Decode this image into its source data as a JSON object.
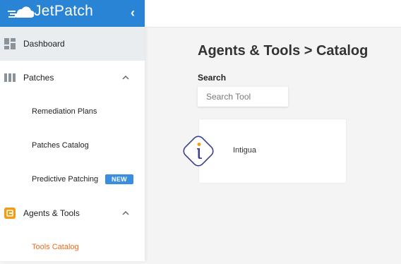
{
  "brand": {
    "name": "JetPatch"
  },
  "nav": {
    "dashboard": "Dashboard",
    "patches": "Patches",
    "patches_children": {
      "remediation_plans": "Remediation Plans",
      "patches_catalog": "Patches Catalog",
      "predictive_patching": "Predictive Patching",
      "new_badge": "NEW"
    },
    "agents_tools": "Agents & Tools",
    "agents_children": {
      "tools_catalog": "Tools Catalog"
    }
  },
  "main": {
    "title": "Agents & Tools > Catalog",
    "search_label": "Search",
    "search_placeholder": "Search Tool",
    "search_value": ""
  },
  "tools": [
    {
      "name": "Intigua",
      "logo_letter": "i"
    }
  ],
  "colors": {
    "brand_blue": "#2a84d6",
    "active_orange": "#f26a1b",
    "agents_icon": "#f39c12",
    "badge_blue": "#3a8ee0",
    "tool_logo": "#3b3f8f"
  },
  "icons": {
    "logo": "cloud-icon",
    "collapse": "chevron-left-icon",
    "dashboard": "dashboard-grid-icon",
    "patches": "columns-icon",
    "agents_tools": "agents-tools-icon",
    "expand": "chevron-up-icon"
  }
}
